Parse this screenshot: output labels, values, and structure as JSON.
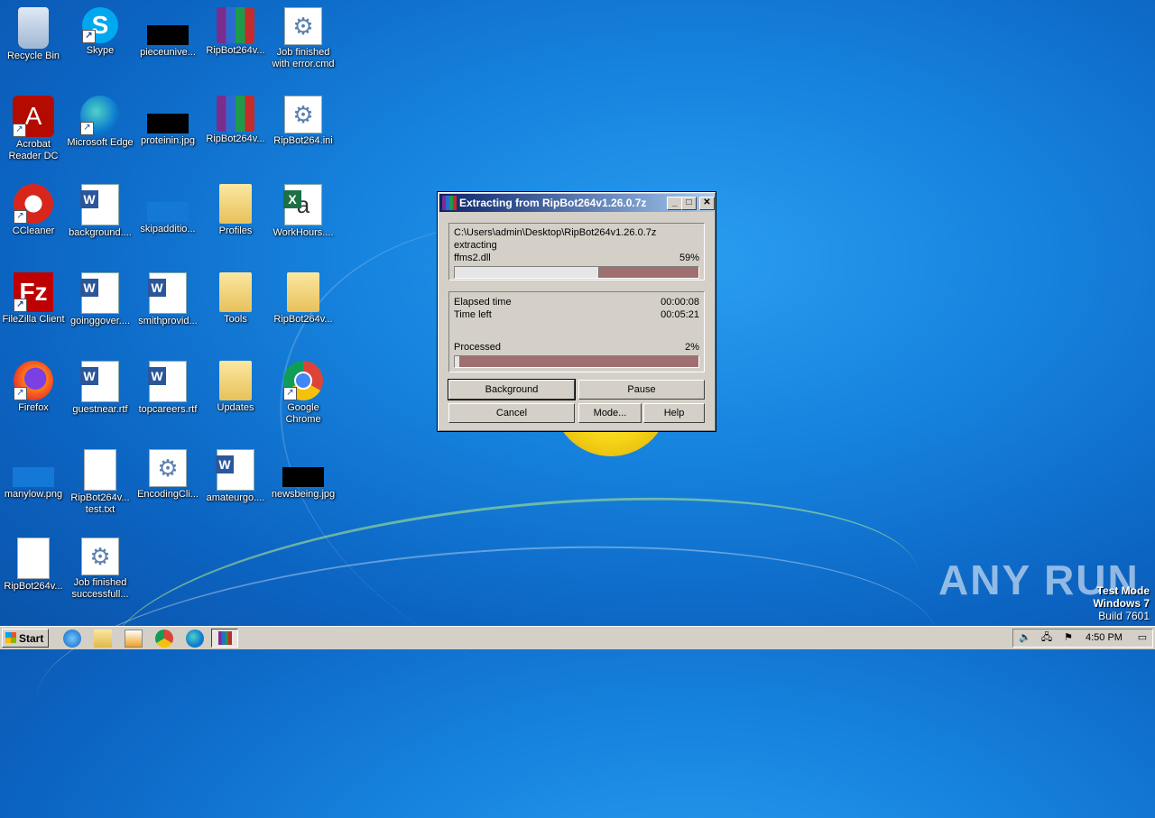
{
  "desktop": {
    "icons": [
      {
        "label": "Recycle Bin",
        "type": "recycle"
      },
      {
        "label": "Skype",
        "type": "skype",
        "glyph": "S"
      },
      {
        "label": "pieceunive...",
        "type": "black"
      },
      {
        "label": "RipBot264v...",
        "type": "rar"
      },
      {
        "label": "Job finished with error.cmd",
        "type": "gear",
        "glyph": "⚙"
      },
      {
        "label": "Acrobat Reader DC",
        "type": "acro",
        "glyph": "A"
      },
      {
        "label": "Microsoft Edge",
        "type": "edge"
      },
      {
        "label": "proteinin.jpg",
        "type": "black"
      },
      {
        "label": "RipBot264v...",
        "type": "rar"
      },
      {
        "label": "RipBot264.ini",
        "type": "gear",
        "glyph": "⚙"
      },
      {
        "label": "CCleaner",
        "type": "ccl"
      },
      {
        "label": "background....",
        "type": "word"
      },
      {
        "label": "skipadditio...",
        "type": "blue"
      },
      {
        "label": "Profiles",
        "type": "folder"
      },
      {
        "label": "WorkHours....",
        "type": "excel",
        "glyph": "a"
      },
      {
        "label": "FileZilla Client",
        "type": "fz",
        "glyph": "Fz"
      },
      {
        "label": "goinggover....",
        "type": "word"
      },
      {
        "label": "smithprovid...",
        "type": "word"
      },
      {
        "label": "Tools",
        "type": "folder"
      },
      {
        "label": "RipBot264v...",
        "type": "folder"
      },
      {
        "label": "Firefox",
        "type": "ffx"
      },
      {
        "label": "guestnear.rtf",
        "type": "word"
      },
      {
        "label": "topcareers.rtf",
        "type": "word"
      },
      {
        "label": "Updates",
        "type": "folder"
      },
      {
        "label": "Google Chrome",
        "type": "chrome"
      },
      {
        "label": "manylow.png",
        "type": "blue"
      },
      {
        "label": "RipBot264v... test.txt",
        "type": "txt"
      },
      {
        "label": "EncodingCli...",
        "type": "gear",
        "glyph": "⚙"
      },
      {
        "label": "amateurgo....",
        "type": "word"
      },
      {
        "label": "newsbeing.jpg",
        "type": "black"
      },
      {
        "label": "RipBot264v...",
        "type": "txt"
      },
      {
        "label": "Job finished successfull...",
        "type": "gear",
        "glyph": "⚙"
      }
    ]
  },
  "dialog": {
    "title": "Extracting from RipBot264v1.26.0.7z",
    "path": "C:\\Users\\admin\\Desktop\\RipBot264v1.26.0.7z",
    "action": "extracting",
    "file": "ffms2.dll",
    "file_percent_text": "59%",
    "file_progress": 0.59,
    "elapsed_label": "Elapsed time",
    "elapsed_value": "00:00:08",
    "left_label": "Time left",
    "left_value": "00:05:21",
    "processed_label": "Processed",
    "processed_percent_text": "2%",
    "processed_progress": 0.02,
    "buttons": {
      "background": "Background",
      "pause": "Pause",
      "cancel": "Cancel",
      "mode": "Mode...",
      "help": "Help"
    },
    "title_buttons": {
      "minimize": "_",
      "maximize": "□",
      "close": "✕"
    }
  },
  "taskbar": {
    "start_label": "Start",
    "clock": "4:50 PM"
  },
  "watermark": {
    "line1": "Test Mode",
    "line2": "Windows 7",
    "line3": "Build 7601"
  },
  "brand": "ANY RUN"
}
